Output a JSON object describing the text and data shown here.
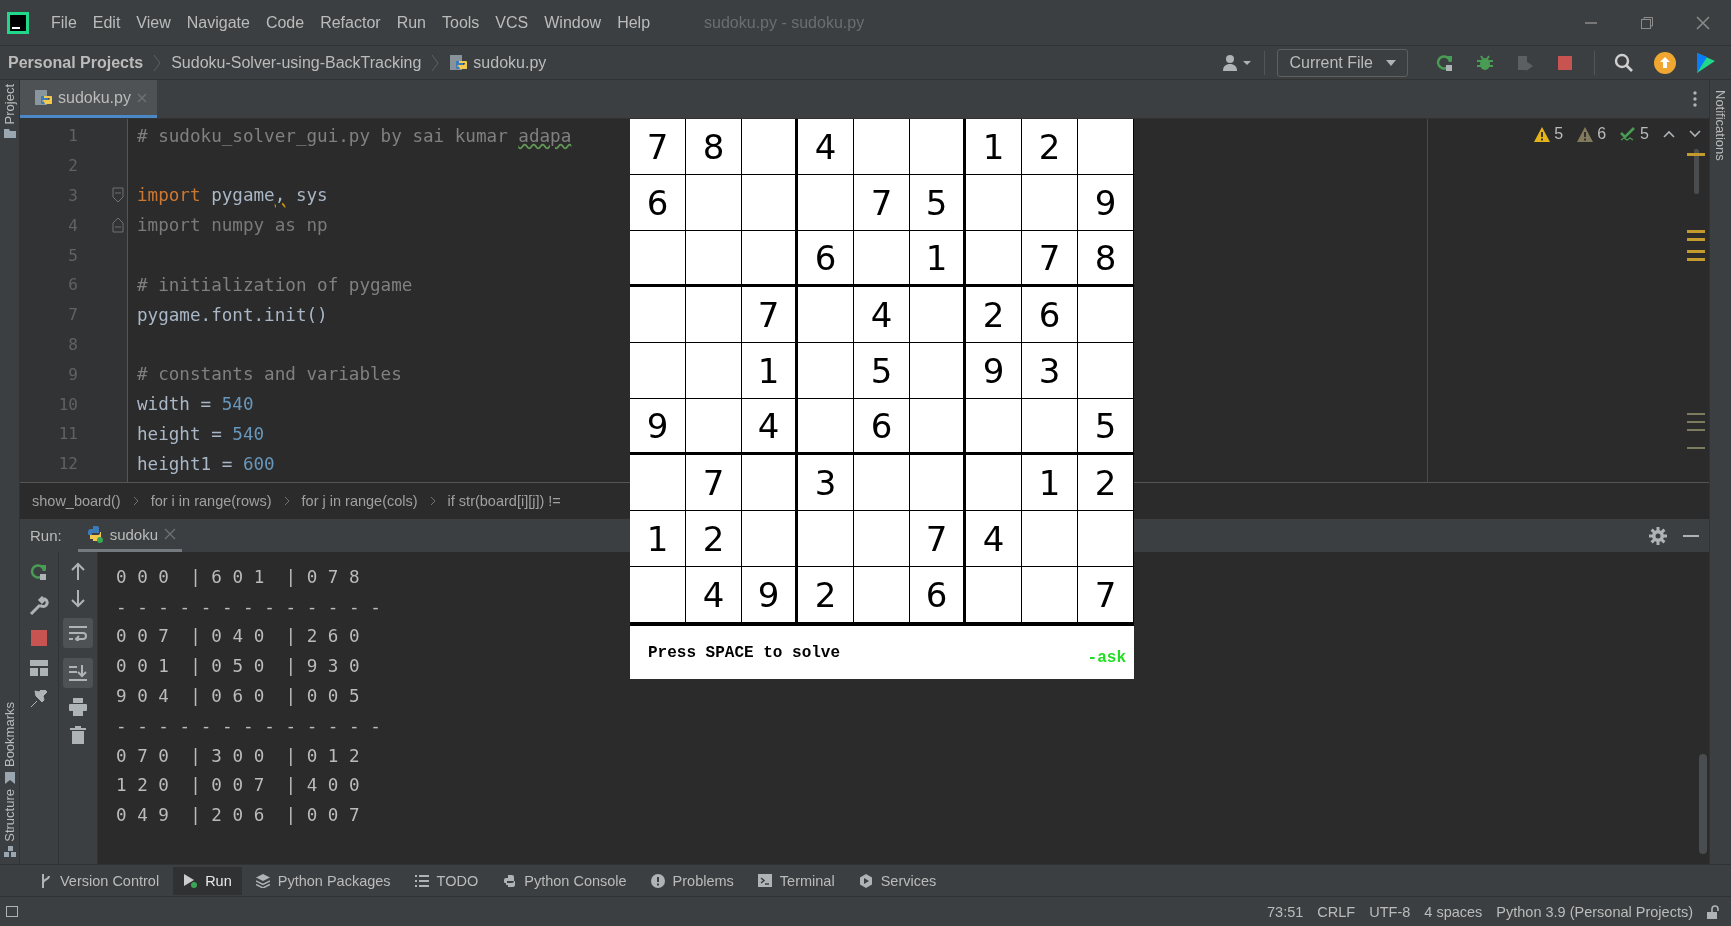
{
  "title_bar": {
    "menu": [
      "File",
      "Edit",
      "View",
      "Navigate",
      "Code",
      "Refactor",
      "Run",
      "Tools",
      "VCS",
      "Window",
      "Help"
    ],
    "title": "sudoku.py - sudoku.py"
  },
  "nav_bar": {
    "breadcrumbs": [
      {
        "label": "Personal Projects",
        "kind": "project"
      },
      {
        "label": "Sudoku-Solver-using-BackTracking",
        "kind": "folder"
      },
      {
        "label": "sudoku.py",
        "kind": "file"
      }
    ],
    "run_config": "Current File"
  },
  "left_strip": {
    "top": [
      "Project"
    ],
    "bottom": [
      "Bookmarks",
      "Structure"
    ]
  },
  "right_strip": [
    "Notifications"
  ],
  "editor_tabs": [
    {
      "label": "sudoku.py",
      "selected": true
    }
  ],
  "editor": {
    "lines": [
      {
        "number": "1",
        "tokens": [
          {
            "kind": "comment",
            "text": "# sudoku_solver_gui.py by sai kumar "
          },
          {
            "kind": "typo",
            "text": "adapa"
          }
        ]
      },
      {
        "number": "2"
      },
      {
        "number": "3",
        "fold_start": true,
        "tokens": [
          {
            "kind": "keyword",
            "text": "import"
          },
          {
            "kind": "plain",
            "text": " pygame"
          },
          {
            "kind": "warn",
            "text": ","
          },
          {
            "kind": "plain",
            "text": " sys"
          }
        ]
      },
      {
        "number": "4",
        "fold_end": true,
        "tokens": [
          {
            "kind": "unused",
            "text": "import numpy as np"
          }
        ]
      },
      {
        "number": "5"
      },
      {
        "number": "6",
        "tokens": [
          {
            "kind": "comment",
            "text": "# initialization of pygame"
          }
        ]
      },
      {
        "number": "7",
        "tokens": [
          {
            "kind": "plain",
            "text": "pygame.font.init()"
          }
        ]
      },
      {
        "number": "8"
      },
      {
        "number": "9",
        "tokens": [
          {
            "kind": "comment",
            "text": "# constants and variables"
          }
        ]
      },
      {
        "number": "10",
        "tokens": [
          {
            "kind": "plain",
            "text": "width = "
          },
          {
            "kind": "number",
            "text": "540"
          }
        ]
      },
      {
        "number": "11",
        "tokens": [
          {
            "kind": "plain",
            "text": "height = "
          },
          {
            "kind": "number",
            "text": "540"
          }
        ]
      },
      {
        "number": "12",
        "tokens": [
          {
            "kind": "plain",
            "text": "height1 = "
          },
          {
            "kind": "number",
            "text": "600"
          }
        ]
      }
    ]
  },
  "inspections": [
    {
      "kind": "warning",
      "count": "5"
    },
    {
      "kind": "weak_warning",
      "count": "6"
    },
    {
      "kind": "typo",
      "count": "5"
    }
  ],
  "breadcrumbs": [
    "show_board()",
    "for i in range(rows)",
    "for j in range(cols)",
    "if str(board[i][j]) !="
  ],
  "run_panel": {
    "label": "Run:",
    "tabs": [
      {
        "label": "sudoku",
        "selected": true
      }
    ],
    "soft_wrap": true,
    "scroll_to_end": true,
    "console": [
      "0 0 0  | 6 0 1  | 0 7 8",
      "- - - - - - - - - - - - -",
      "0 0 7  | 0 4 0  | 2 6 0",
      "0 0 1  | 0 5 0  | 9 3 0",
      "9 0 4  | 0 6 0  | 0 0 5",
      "- - - - - - - - - - - - -",
      "0 7 0  | 3 0 0  | 0 1 2",
      "1 2 0  | 0 0 7  | 4 0 0",
      "0 4 9  | 2 0 6  | 0 0 7"
    ]
  },
  "pygame_window": {
    "grid": [
      [
        {
          "kind": "digit",
          "value": "7"
        },
        {
          "kind": "digit",
          "value": "8"
        },
        {
          "kind": "empty"
        },
        {
          "kind": "digit",
          "value": "4"
        },
        {
          "kind": "empty"
        },
        {
          "kind": "empty"
        },
        {
          "kind": "digit",
          "value": "1"
        },
        {
          "kind": "digit",
          "value": "2"
        },
        {
          "kind": "empty"
        }
      ],
      [
        {
          "kind": "digit",
          "value": "6"
        },
        {
          "kind": "empty"
        },
        {
          "kind": "empty"
        },
        {
          "kind": "empty"
        },
        {
          "kind": "digit",
          "value": "7"
        },
        {
          "kind": "digit",
          "value": "5"
        },
        {
          "kind": "empty"
        },
        {
          "kind": "empty"
        },
        {
          "kind": "digit",
          "value": "9"
        }
      ],
      [
        {
          "kind": "empty"
        },
        {
          "kind": "empty"
        },
        {
          "kind": "empty"
        },
        {
          "kind": "digit",
          "value": "6"
        },
        {
          "kind": "empty"
        },
        {
          "kind": "digit",
          "value": "1"
        },
        {
          "kind": "empty"
        },
        {
          "kind": "digit",
          "value": "7"
        },
        {
          "kind": "digit",
          "value": "8"
        }
      ],
      [
        {
          "kind": "empty"
        },
        {
          "kind": "empty"
        },
        {
          "kind": "digit",
          "value": "7"
        },
        {
          "kind": "empty"
        },
        {
          "kind": "digit",
          "value": "4"
        },
        {
          "kind": "empty"
        },
        {
          "kind": "digit",
          "value": "2"
        },
        {
          "kind": "digit",
          "value": "6"
        },
        {
          "kind": "empty"
        }
      ],
      [
        {
          "kind": "empty"
        },
        {
          "kind": "empty"
        },
        {
          "kind": "digit",
          "value": "1"
        },
        {
          "kind": "empty"
        },
        {
          "kind": "digit",
          "value": "5"
        },
        {
          "kind": "empty"
        },
        {
          "kind": "digit",
          "value": "9"
        },
        {
          "kind": "digit",
          "value": "3"
        },
        {
          "kind": "empty"
        }
      ],
      [
        {
          "kind": "digit",
          "value": "9"
        },
        {
          "kind": "empty"
        },
        {
          "kind": "digit",
          "value": "4"
        },
        {
          "kind": "empty"
        },
        {
          "kind": "digit",
          "value": "6"
        },
        {
          "kind": "empty"
        },
        {
          "kind": "empty"
        },
        {
          "kind": "empty"
        },
        {
          "kind": "digit",
          "value": "5"
        }
      ],
      [
        {
          "kind": "empty"
        },
        {
          "kind": "digit",
          "value": "7"
        },
        {
          "kind": "empty"
        },
        {
          "kind": "digit",
          "value": "3"
        },
        {
          "kind": "empty"
        },
        {
          "kind": "empty"
        },
        {
          "kind": "empty"
        },
        {
          "kind": "digit",
          "value": "1"
        },
        {
          "kind": "digit",
          "value": "2"
        }
      ],
      [
        {
          "kind": "digit",
          "value": "1"
        },
        {
          "kind": "digit",
          "value": "2"
        },
        {
          "kind": "empty"
        },
        {
          "kind": "empty"
        },
        {
          "kind": "empty"
        },
        {
          "kind": "digit",
          "value": "7"
        },
        {
          "kind": "digit",
          "value": "4"
        },
        {
          "kind": "empty"
        },
        {
          "kind": "empty"
        }
      ],
      [
        {
          "kind": "empty"
        },
        {
          "kind": "digit",
          "value": "4"
        },
        {
          "kind": "digit",
          "value": "9"
        },
        {
          "kind": "digit",
          "value": "2"
        },
        {
          "kind": "empty"
        },
        {
          "kind": "digit",
          "value": "6"
        },
        {
          "kind": "empty"
        },
        {
          "kind": "empty"
        },
        {
          "kind": "digit",
          "value": "7"
        }
      ]
    ],
    "prompt": "Press SPACE to solve",
    "signature": "-ask"
  },
  "tool_windows": [
    {
      "kind": "vcs",
      "label": "Version Control",
      "selected": false
    },
    {
      "kind": "run",
      "label": "Run",
      "selected": true
    },
    {
      "kind": "packages",
      "label": "Python Packages",
      "selected": false
    },
    {
      "kind": "todo",
      "label": "TODO",
      "selected": false
    },
    {
      "kind": "console",
      "label": "Python Console",
      "selected": false
    },
    {
      "kind": "problems",
      "label": "Problems",
      "selected": false
    },
    {
      "kind": "terminal",
      "label": "Terminal",
      "selected": false
    },
    {
      "kind": "services",
      "label": "Services",
      "selected": false
    }
  ],
  "status_bar": [
    "73:51",
    "CRLF",
    "UTF-8",
    "4 spaces",
    "Python 3.9 (Personal Projects)"
  ]
}
